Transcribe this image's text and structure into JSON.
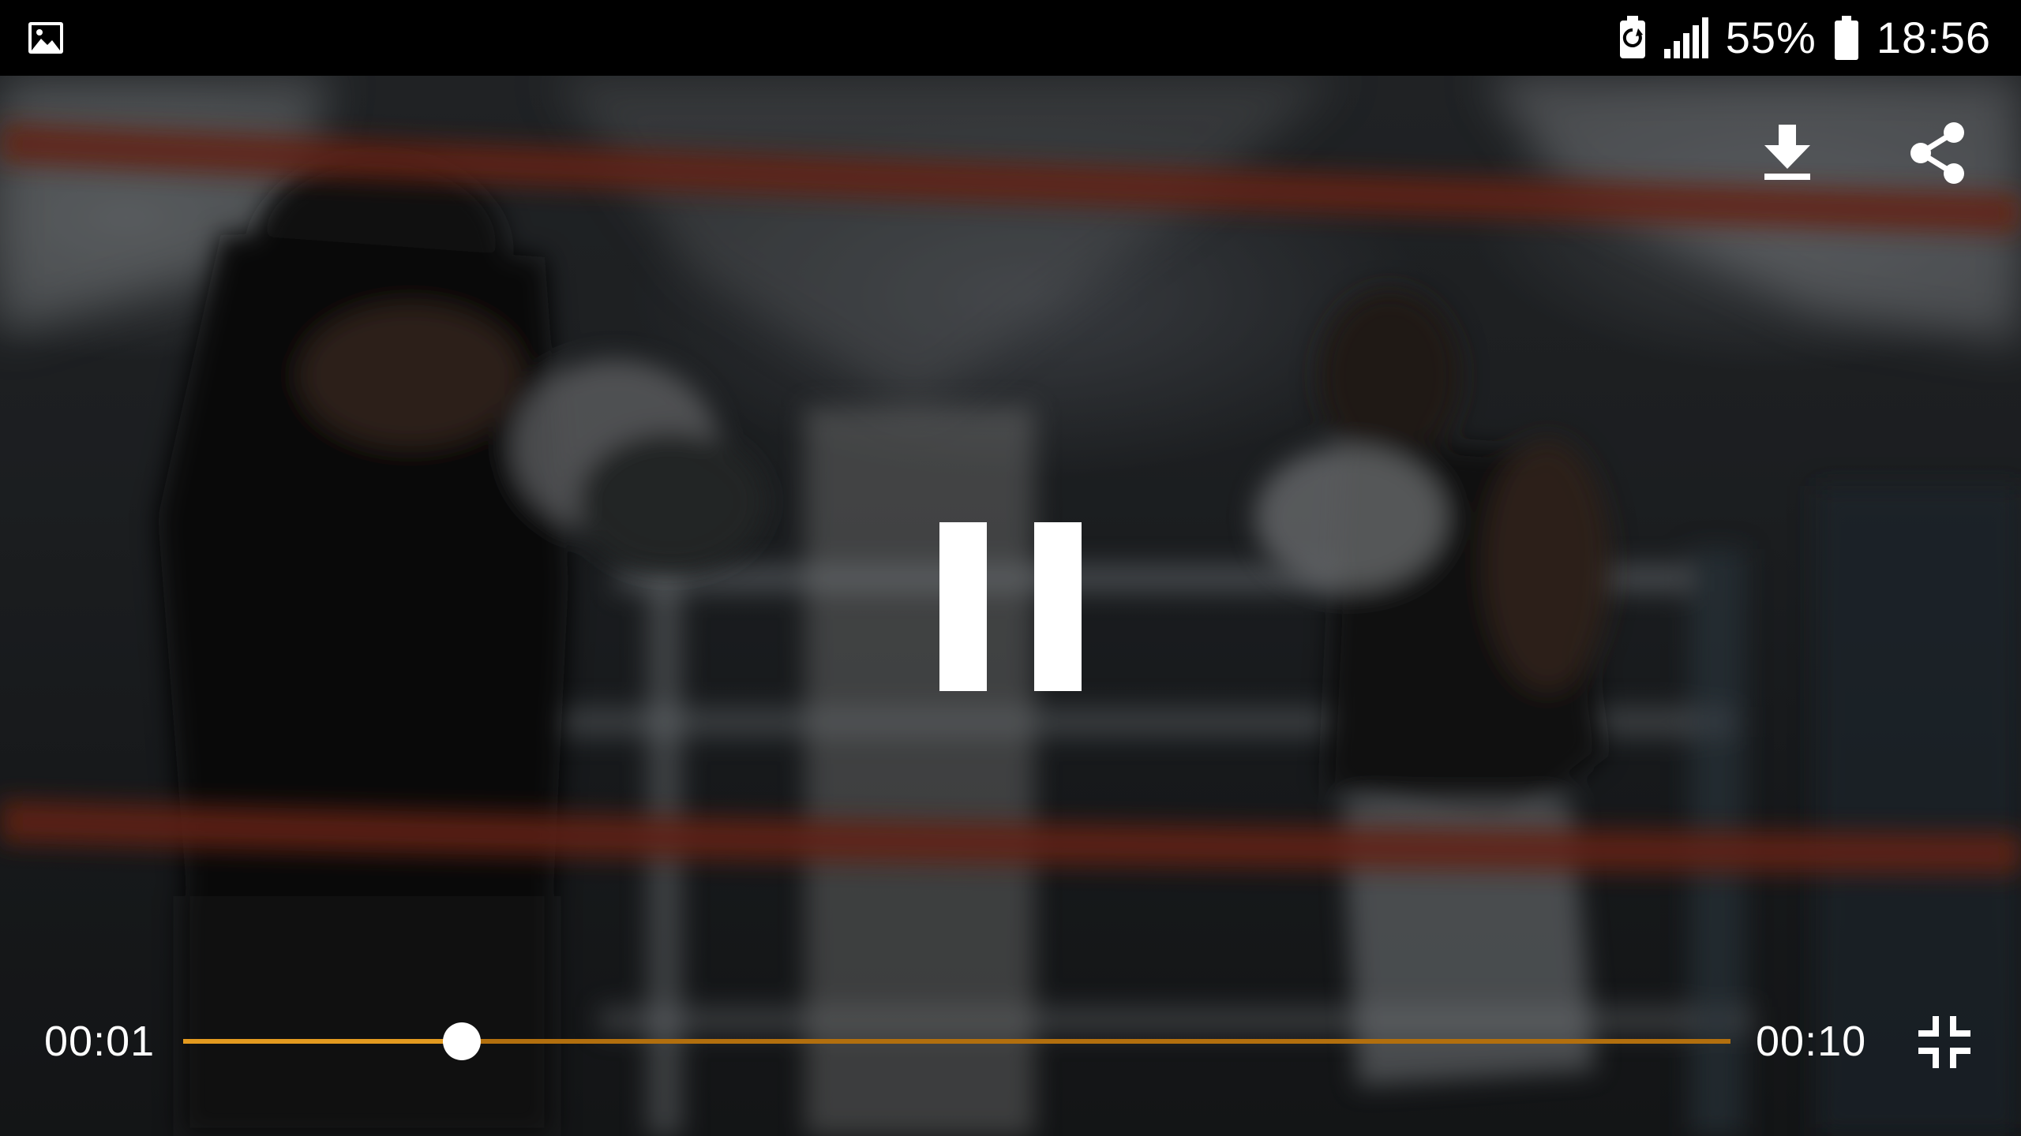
{
  "status_bar": {
    "left_icon": "gallery-notification-icon",
    "icons": [
      "battery-saver-icon",
      "cellular-signal-icon",
      "battery-icon"
    ],
    "battery_percent_text": "55%",
    "clock": "18:56"
  },
  "player": {
    "state": "playing",
    "top_actions": {
      "download_icon": "download-icon",
      "share_icon": "share-icon"
    },
    "center_icon": "pause-icon",
    "current_time": "00:01",
    "total_time": "00:10",
    "progress_fraction": 0.18,
    "fullscreen_icon": "exit-fullscreen-icon",
    "colors": {
      "seek_played": "#e39a1f",
      "seek_track": "#b26f0e",
      "thumb": "#ffffff"
    }
  }
}
